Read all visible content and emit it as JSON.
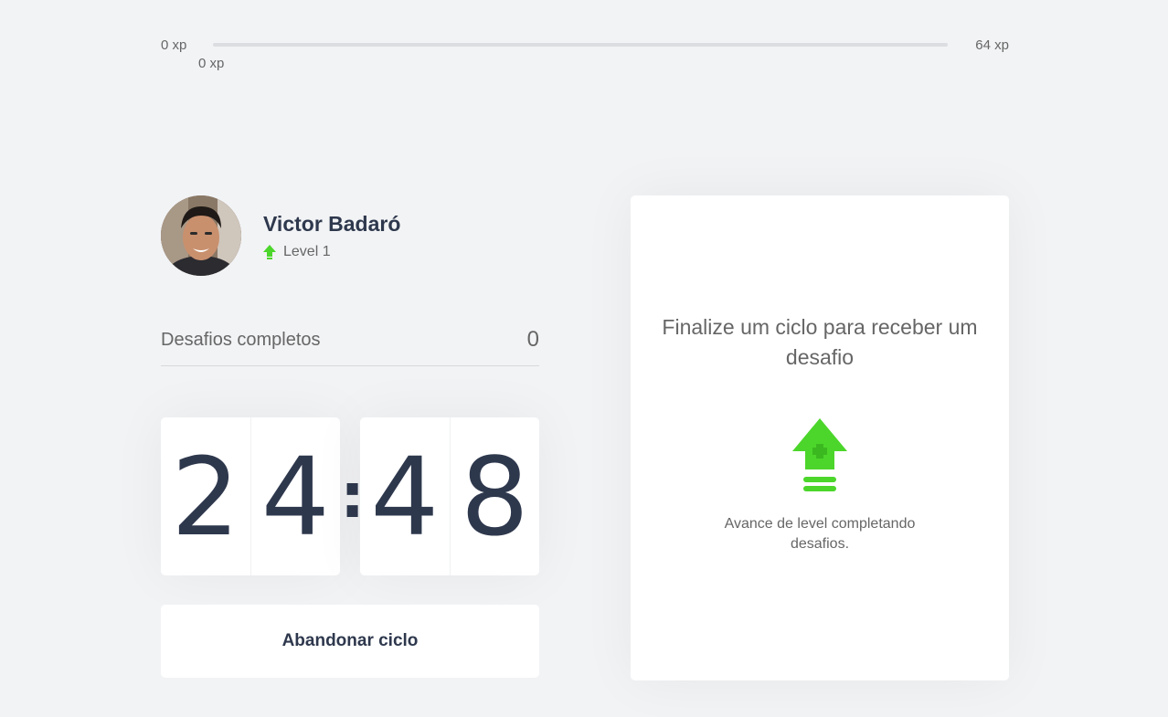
{
  "experience": {
    "min_label": "0 xp",
    "max_label": "64 xp",
    "current_label": "0 xp",
    "progress_percent": 0,
    "accent_color": "#4cd62b"
  },
  "profile": {
    "name": "Victor Badaró",
    "level_label": "Level 1",
    "level_icon": "level-up-arrow-icon"
  },
  "challenges": {
    "label": "Desafios completos",
    "count": "0"
  },
  "countdown": {
    "minute_left": "2",
    "minute_right": "4",
    "separator": ":",
    "second_left": "4",
    "second_right": "8"
  },
  "actions": {
    "abandon_label": "Abandonar ciclo"
  },
  "challenge_box": {
    "title": "Finalize um ciclo para receber um desafio",
    "icon": "level-up-icon",
    "hint": "Avance de level completando desafios."
  }
}
